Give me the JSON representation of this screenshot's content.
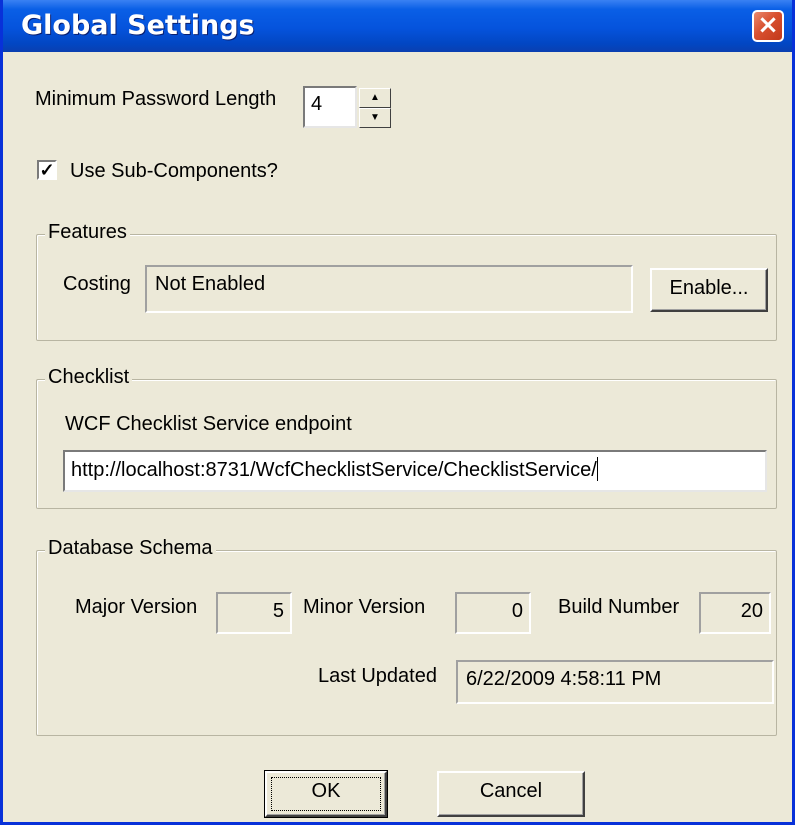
{
  "window": {
    "title": "Global Settings",
    "close_glyph": "×"
  },
  "password": {
    "label": "Minimum Password Length",
    "value": "4",
    "spin_up_glyph": "▲",
    "spin_down_glyph": "▼"
  },
  "subcomponents": {
    "label": "Use Sub-Components?",
    "checked": true,
    "check_glyph": "✓"
  },
  "features": {
    "title": "Features",
    "costing_label": "Costing",
    "costing_value": "Not Enabled",
    "enable_button": "Enable..."
  },
  "checklist": {
    "title": "Checklist",
    "endpoint_label": "WCF Checklist Service endpoint",
    "endpoint_value": "http://localhost:8731/WcfChecklistService/ChecklistService/"
  },
  "schema": {
    "title": "Database Schema",
    "major_label": "Major Version",
    "major_value": "5",
    "minor_label": "Minor Version",
    "minor_value": "0",
    "build_label": "Build Number",
    "build_value": "20",
    "updated_label": "Last Updated",
    "updated_value": "6/22/2009 4:58:11 PM"
  },
  "footer": {
    "ok_button": "OK",
    "cancel_button": "Cancel"
  },
  "colors": {
    "titlebar": "#0553dc",
    "dialog_bg": "#ece9d8",
    "close_button": "#d8502f"
  }
}
